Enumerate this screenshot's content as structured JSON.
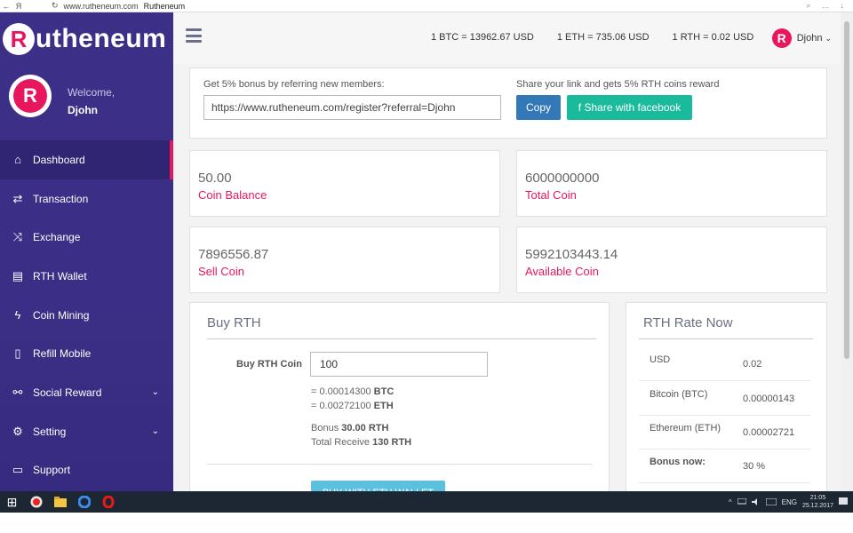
{
  "browser": {
    "url": "www.rutheneum.com",
    "tab_title": "Rutheneum",
    "back_glyph": "←",
    "yandex_glyph": "Я",
    "reload_glyph": "↻",
    "search_glyph": "⌕",
    "menu_glyph": "…",
    "download_glyph": "↓"
  },
  "brand": {
    "logo_letter": "R",
    "logo_word": "utheneum",
    "accent": "#e8175d",
    "sidebar_bg": "#3c2f88"
  },
  "user": {
    "welcome": "Welcome,",
    "name": "Djohn",
    "avatar_letter": "R"
  },
  "sidebar": {
    "items": [
      {
        "label": "Dashboard",
        "icon": "home-icon",
        "glyph": "⌂",
        "active": true
      },
      {
        "label": "Transaction",
        "icon": "swap-icon",
        "glyph": "⇄"
      },
      {
        "label": "Exchange",
        "icon": "shuffle-icon",
        "glyph": "⤨"
      },
      {
        "label": "RTH Wallet",
        "icon": "wallet-icon",
        "glyph": "▤"
      },
      {
        "label": "Coin Mining",
        "icon": "bolt-icon",
        "glyph": "ϟ"
      },
      {
        "label": "Refill Mobile",
        "icon": "mobile-icon",
        "glyph": "▯"
      },
      {
        "label": "Social Reward",
        "icon": "social-icon",
        "glyph": "⚯",
        "chevron": "⌄"
      },
      {
        "label": "Setting",
        "icon": "gear-icon",
        "glyph": "⚙",
        "chevron": "⌄"
      },
      {
        "label": "Support",
        "icon": "laptop-icon",
        "glyph": "▭"
      }
    ]
  },
  "topbar": {
    "rates": [
      "1 BTC = 13962.67 USD",
      "1 ETH = 735.06 USD",
      "1 RTH = 0.02 USD"
    ],
    "user_name": "Djohn",
    "avatar_letter": "R",
    "chevron": "⌄"
  },
  "referral": {
    "bonus_label": "Get 5% bonus by referring new members:",
    "share_label": "Share your link and gets 5% RTH coins reward",
    "link": "https://www.rutheneum.com/register?referral=Djohn",
    "copy_label": "Copy",
    "facebook_label": "f Share with facebook"
  },
  "stats": [
    {
      "value": "50.00",
      "label": "Coin Balance"
    },
    {
      "value": "6000000000",
      "label": "Total Coin"
    },
    {
      "value": "7896556.87",
      "label": "Sell Coin"
    },
    {
      "value": "5992103443.14",
      "label": "Available Coin"
    }
  ],
  "buy": {
    "title": "Buy RTH",
    "field_label": "Buy RTH Coin",
    "amount": "100",
    "btc_eq": "= 0.00014300",
    "btc_unit": "BTC",
    "eth_eq": "= 0.00272100",
    "eth_unit": "ETH",
    "bonus_label": "Bonus",
    "bonus_value": "30.00 RTH",
    "total_label": "Total Receive",
    "total_value": "130 RTH",
    "button_label": "BUY WITH ETH WALLET"
  },
  "rate_now": {
    "title": "RTH Rate Now",
    "rows": [
      {
        "key": "USD",
        "value": "0.02"
      },
      {
        "key": "Bitcoin (BTC)",
        "value": "0.00000143"
      },
      {
        "key": "Ethereum (ETH)",
        "value": "0.00002721"
      },
      {
        "key": "Bonus now:",
        "value": "30 %"
      }
    ]
  },
  "taskbar": {
    "start_glyph": "⊞",
    "tray_arrow": "^",
    "lang": "ENG",
    "time": "21:05",
    "date": "25.12.2017"
  }
}
